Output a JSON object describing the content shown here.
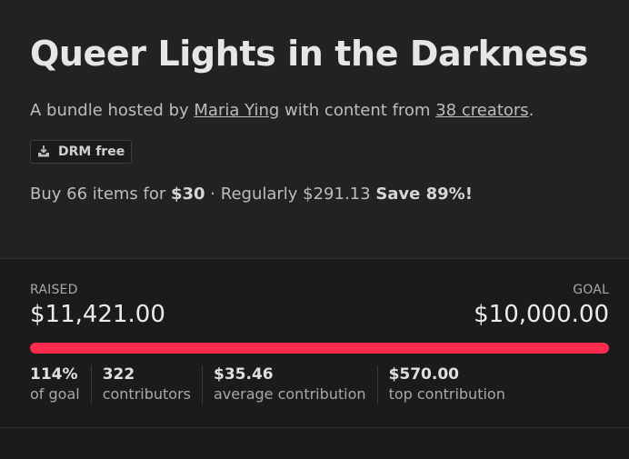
{
  "bundle": {
    "title": "Queer Lights in the Darkness",
    "host_prefix": "A bundle hosted by ",
    "host_name": "Maria Ying",
    "host_middle": " with content from ",
    "creators_link": "38 creators",
    "host_suffix": ".",
    "drm_badge": {
      "icon": "download-icon",
      "label": "DRM free"
    }
  },
  "pricing": {
    "prefix": "Buy 66 items for ",
    "price": "$30",
    "middle": " · Regularly $291.13 ",
    "save": "Save 89%!"
  },
  "funding": {
    "raised_label": "RAISED",
    "raised_amount": "$11,421.00",
    "goal_label": "GOAL",
    "goal_amount": "$10,000.00",
    "progress_fraction": 1.0,
    "progress_color": "#ff2b4d",
    "stats": [
      {
        "value": "114%",
        "caption": "of goal"
      },
      {
        "value": "322",
        "caption": "contributors"
      },
      {
        "value": "$35.46",
        "caption": "average contribution"
      },
      {
        "value": "$570.00",
        "caption": "top contribution"
      }
    ]
  }
}
